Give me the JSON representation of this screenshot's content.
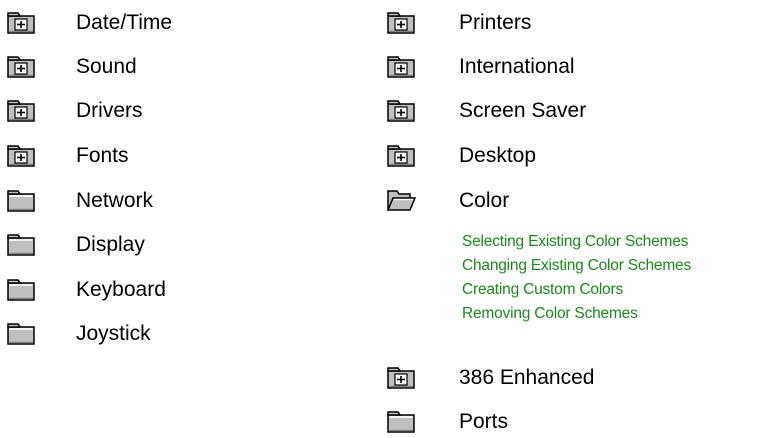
{
  "left_column": {
    "items": [
      {
        "label": "Date/Time",
        "icon": "folder-plus-icon"
      },
      {
        "label": "Sound",
        "icon": "folder-plus-icon"
      },
      {
        "label": "Drivers",
        "icon": "folder-plus-icon"
      },
      {
        "label": "Fonts",
        "icon": "folder-plus-icon"
      },
      {
        "label": "Network",
        "icon": "folder-closed-icon"
      },
      {
        "label": "Display",
        "icon": "folder-closed-icon"
      },
      {
        "label": "Keyboard",
        "icon": "folder-closed-icon"
      },
      {
        "label": "Joystick",
        "icon": "folder-closed-icon"
      }
    ]
  },
  "right_column": {
    "items": [
      {
        "label": "Printers",
        "icon": "folder-plus-icon"
      },
      {
        "label": "International",
        "icon": "folder-plus-icon"
      },
      {
        "label": "Screen Saver",
        "icon": "folder-plus-icon"
      },
      {
        "label": "Desktop",
        "icon": "folder-plus-icon"
      },
      {
        "label": "Color",
        "icon": "folder-open-icon"
      },
      {
        "label": "386 Enhanced",
        "icon": "folder-plus-icon"
      },
      {
        "label": "Ports",
        "icon": "folder-closed-icon"
      }
    ],
    "color_topics": [
      "Selecting Existing Color Schemes",
      "Changing Existing Color Schemes",
      "Creating Custom Colors",
      "Removing Color Schemes"
    ]
  },
  "colors": {
    "link": "#1a8a1a",
    "text": "#000000",
    "background": "#ffffff"
  }
}
